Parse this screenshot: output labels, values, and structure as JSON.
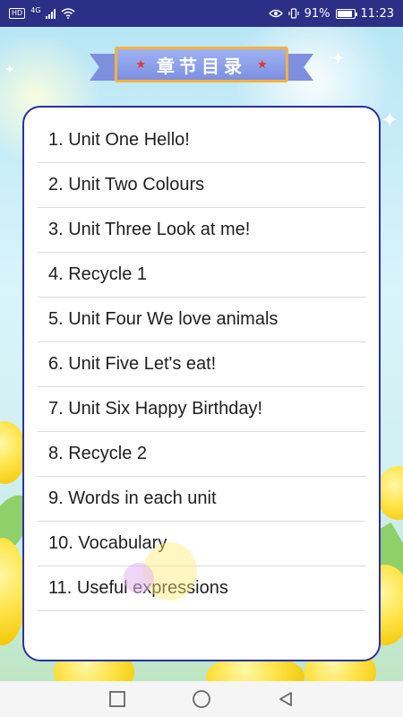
{
  "status_bar": {
    "hd_label": "HD",
    "network_label": "4G",
    "percent": "91%",
    "time": "11:23",
    "icons": [
      "eye-icon",
      "vibrate-icon",
      "battery-icon",
      "wifi-icon",
      "signal-icon"
    ]
  },
  "header": {
    "title": "章节目录"
  },
  "chapters": [
    {
      "label": "1. Unit One Hello!"
    },
    {
      "label": "2. Unit Two Colours"
    },
    {
      "label": "3. Unit Three Look at me!"
    },
    {
      "label": "4. Recycle 1"
    },
    {
      "label": "5. Unit Four We love animals"
    },
    {
      "label": "6. Unit Five Let's eat!"
    },
    {
      "label": "7. Unit Six Happy Birthday!"
    },
    {
      "label": "8. Recycle 2"
    },
    {
      "label": "9. Words in each unit"
    },
    {
      "label": "10. Vocabulary"
    },
    {
      "label": "11. Useful expressions"
    }
  ],
  "nav_bar": {
    "icons": [
      "recents-square-icon",
      "home-circle-icon",
      "back-triangle-icon"
    ]
  },
  "colors": {
    "status_bar": "#2c2f86",
    "card_border": "#2d2fa6",
    "banner": "#7d8fe3",
    "banner_border": "#f6b13b",
    "star": "#e8332c"
  }
}
